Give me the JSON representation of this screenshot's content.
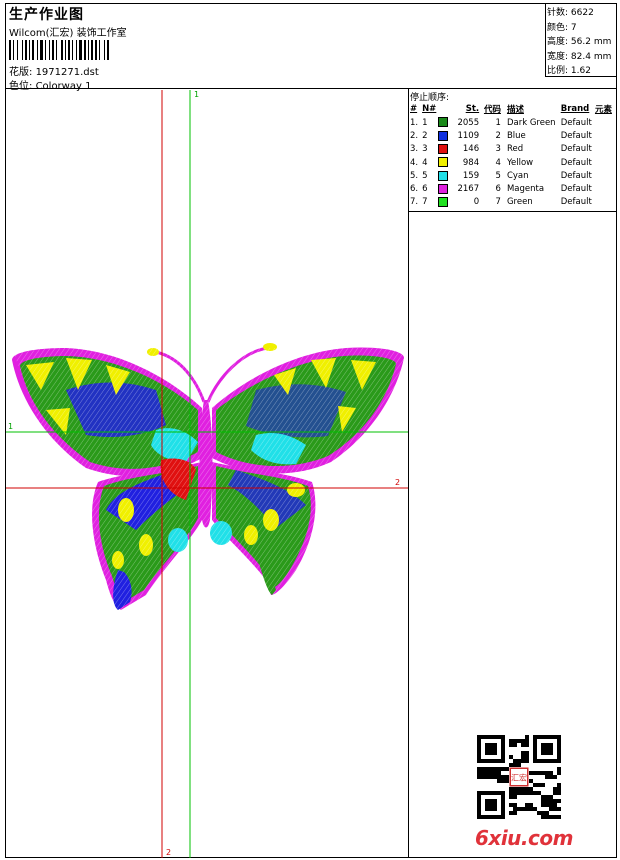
{
  "header": {
    "title": "生产作业图",
    "company": "Wilcom(汇宏) 装饰工作室",
    "design_label": "花版:",
    "design_value": "1971271.dst",
    "colorway_label": "色位:",
    "colorway_value": "Colorway 1"
  },
  "stats": [
    {
      "label": "针数:",
      "value": "6622"
    },
    {
      "label": "颜色:",
      "value": "7"
    },
    {
      "label": "高度:",
      "value": "56.2 mm"
    },
    {
      "label": "宽度:",
      "value": "82.4 mm"
    },
    {
      "label": "比例:",
      "value": "1.62"
    }
  ],
  "stop_sequence": {
    "title": "停止顺序:",
    "columns": [
      "#",
      "N#",
      "",
      "St.",
      "代码",
      "描述",
      "Brand",
      "元素"
    ],
    "rows": [
      {
        "num": "1.",
        "n": "1",
        "color": "#1a8a1a",
        "st": "2055",
        "code": "1",
        "desc": "Dark Green",
        "brand": "Default"
      },
      {
        "num": "2.",
        "n": "2",
        "color": "#1030e0",
        "st": "1109",
        "code": "2",
        "desc": "Blue",
        "brand": "Default"
      },
      {
        "num": "3.",
        "n": "3",
        "color": "#e01010",
        "st": "146",
        "code": "3",
        "desc": "Red",
        "brand": "Default"
      },
      {
        "num": "4.",
        "n": "4",
        "color": "#f0f000",
        "st": "984",
        "code": "4",
        "desc": "Yellow",
        "brand": "Default"
      },
      {
        "num": "5.",
        "n": "5",
        "color": "#20e0e8",
        "st": "159",
        "code": "5",
        "desc": "Cyan",
        "brand": "Default"
      },
      {
        "num": "6.",
        "n": "6",
        "color": "#e020e0",
        "st": "2167",
        "code": "6",
        "desc": "Magenta",
        "brand": "Default"
      },
      {
        "num": "7.",
        "n": "7",
        "color": "#20e020",
        "st": "0",
        "code": "7",
        "desc": "Green",
        "brand": "Default"
      }
    ]
  },
  "reference_lines": {
    "vertical_green_label": "1",
    "horizontal_green_label": "1",
    "horizontal_red_label": "2",
    "vertical_red_label": "2",
    "green": "#00c000",
    "red": "#d00000"
  },
  "watermark": {
    "text": "6xiu.com",
    "seal_text": "汇宏"
  }
}
